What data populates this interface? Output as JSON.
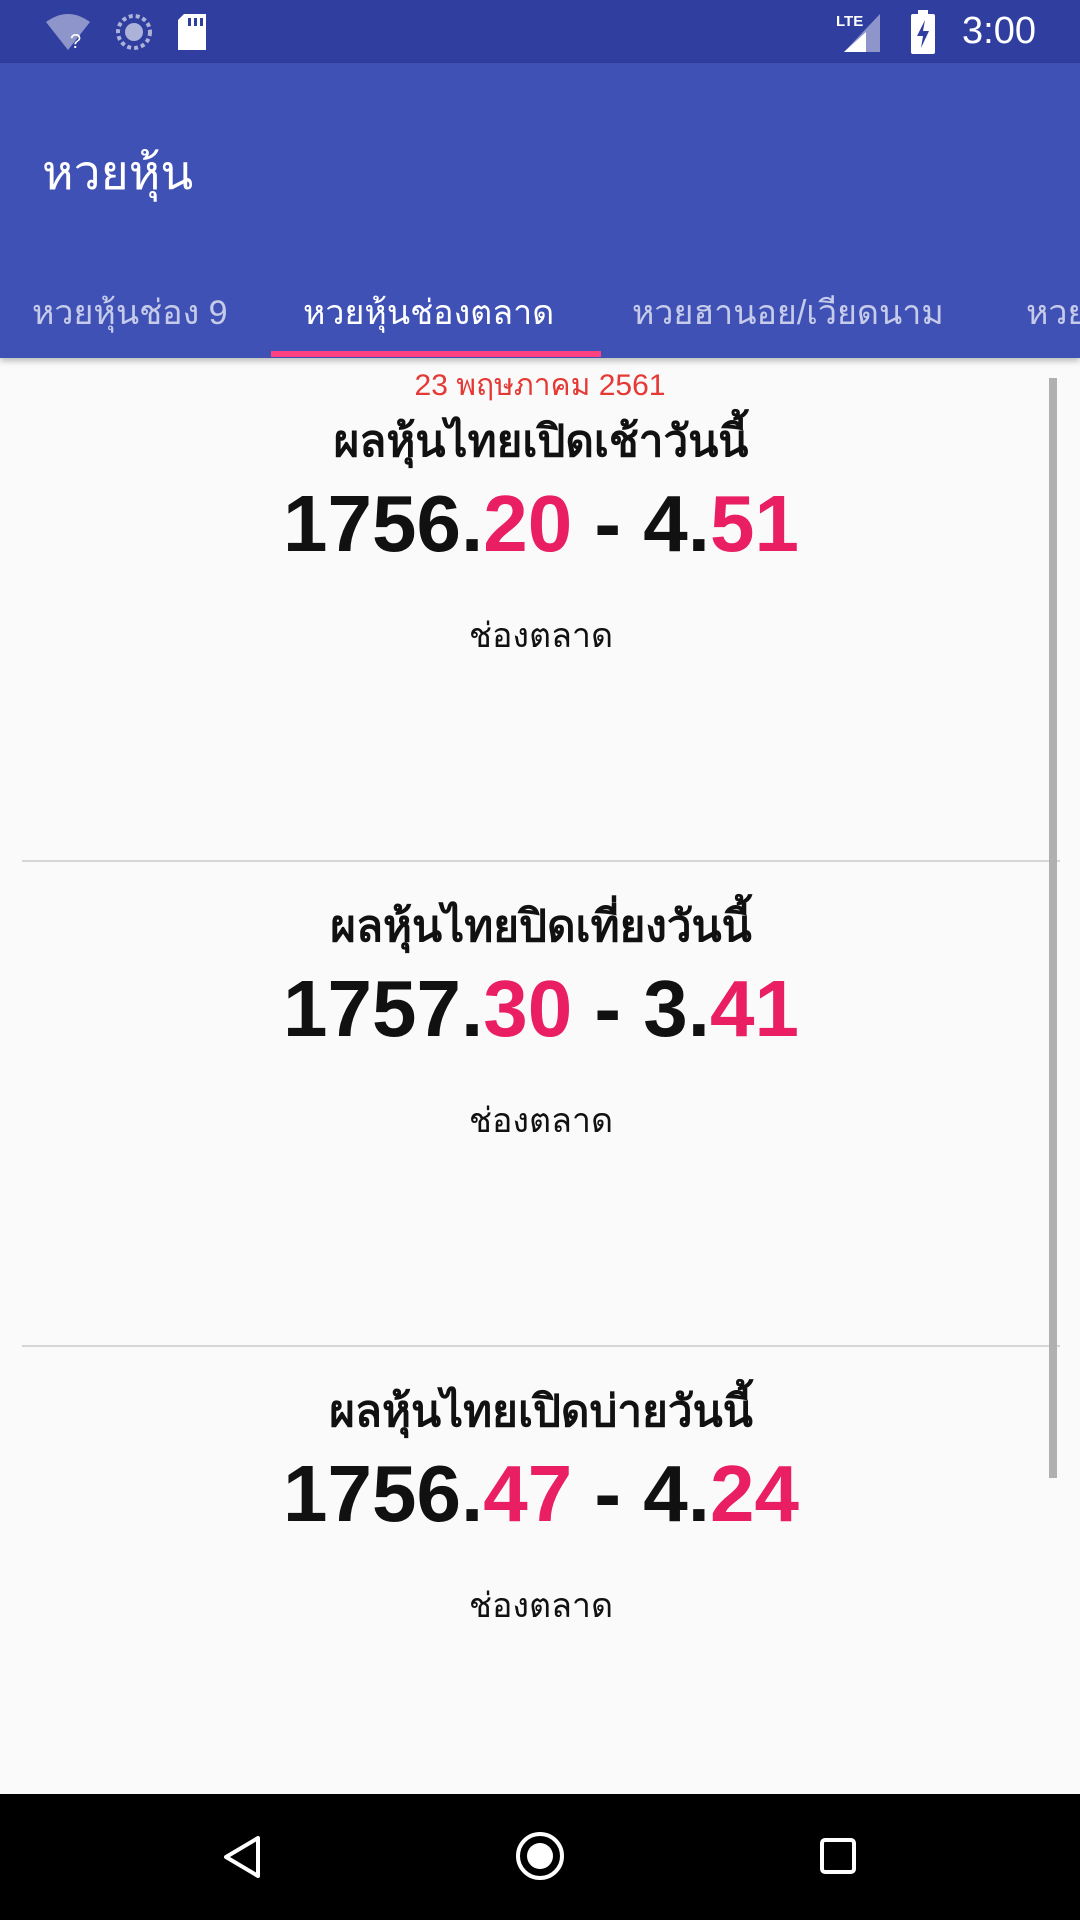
{
  "status_bar": {
    "time": "3:00",
    "network": "LTE",
    "icons": [
      "wifi-unknown-icon",
      "sync-icon",
      "sd-card-icon",
      "lte-signal-icon",
      "battery-charging-icon"
    ]
  },
  "app_bar": {
    "title": "หวยหุ้น"
  },
  "tabs": [
    {
      "label": "หวยหุ้นช่อง 9"
    },
    {
      "label": "หวยหุ้นช่องตลาด"
    },
    {
      "label": "หวยฮานอย/เวียดนาม"
    },
    {
      "label": "หวย"
    }
  ],
  "active_tab": "หวยหุ้นช่องตลาด",
  "date": "23 พฤษภาคม  2561",
  "cards": [
    {
      "title": "ผลหุ้นไทยเปิดเช้าวันนี้",
      "main_prefix": "1756.",
      "main_suffix": "20",
      "separator": " - ",
      "change_prefix": "4.",
      "change_suffix": "51",
      "source": "ช่องตลาด"
    },
    {
      "title": "ผลหุ้นไทยปิดเที่ยงวันนี้",
      "main_prefix": "1757.",
      "main_suffix": "30",
      "separator": " - ",
      "change_prefix": "3.",
      "change_suffix": "41",
      "source": "ช่องตลาด"
    },
    {
      "title": "ผลหุ้นไทยเปิดบ่ายวันนี้",
      "main_prefix": "1756.",
      "main_suffix": "47",
      "separator": " - ",
      "change_prefix": "4.",
      "change_suffix": "24",
      "source": "ช่องตลาด"
    }
  ],
  "colors": {
    "status_bar": "#303f9f",
    "app_bar": "#3f51b5",
    "accent": "#ff4081",
    "highlight_digits": "#e91e63",
    "date_text": "#e53935"
  }
}
